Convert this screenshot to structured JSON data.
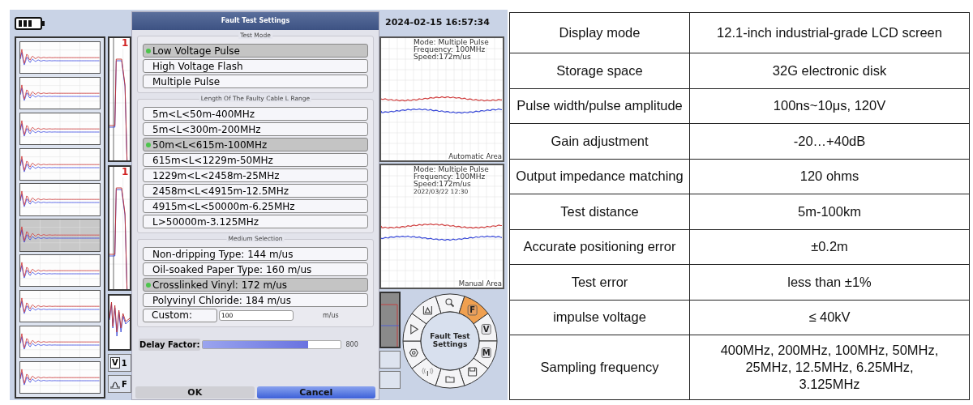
{
  "thumbnails": [
    {
      "selected": false
    },
    {
      "selected": false
    },
    {
      "selected": false
    },
    {
      "selected": false
    },
    {
      "selected": false
    },
    {
      "selected": true
    },
    {
      "selected": false
    },
    {
      "selected": false
    },
    {
      "selected": false
    },
    {
      "selected": false
    }
  ],
  "side_plots": {
    "labels": [
      "1",
      "1"
    ],
    "channel_key": "V",
    "channel_value": "1",
    "filter_label": "F"
  },
  "datetime": "2024-02-15 16:57:34",
  "plots": [
    {
      "info": [
        "Mode: Multiple Pulse",
        "Frequency: 100MHz",
        "Speed:172m/us"
      ],
      "area": "Automatic Area"
    },
    {
      "info": [
        "Mode: Multiple Pulse",
        "Frequency: 100MHz",
        "Speed:172m/us",
        "2022/03/22 12:30"
      ],
      "area": "Manual Area"
    }
  ],
  "dialog": {
    "title": "Fault Test Settings",
    "sections": [
      {
        "title": "Test Mode",
        "options": [
          {
            "label": "Low Voltage Pulse",
            "selected": true
          },
          {
            "label": "High Voltage Flash",
            "selected": false
          },
          {
            "label": "Multiple Pulse",
            "selected": false
          }
        ]
      },
      {
        "title": "Length Of The Faulty Cable L Range",
        "options": [
          {
            "label": "5m<L<50m-400MHz",
            "selected": false
          },
          {
            "label": "5m<L<300m-200MHz",
            "selected": false
          },
          {
            "label": "50m<L<615m-100MHz",
            "selected": true
          },
          {
            "label": "615m<L<1229m-50MHz",
            "selected": false
          },
          {
            "label": "1229m<L<2458m-25MHz",
            "selected": false
          },
          {
            "label": "2458m<L<4915m-12.5MHz",
            "selected": false
          },
          {
            "label": "4915m<L<50000m-6.25MHz",
            "selected": false
          },
          {
            "label": "L>50000m-3.125MHz",
            "selected": false
          }
        ]
      },
      {
        "title": "Medium Selection",
        "options": [
          {
            "label": "Non-dripping Type: 144 m/us",
            "selected": false
          },
          {
            "label": "Oil-soaked Paper Type: 160 m/us",
            "selected": false
          },
          {
            "label": "Crosslinked Vinyl: 172 m/us",
            "selected": true
          },
          {
            "label": "Polyvinyl Chloride: 184 m/us",
            "selected": false
          }
        ],
        "custom": {
          "label": "Custom:",
          "value": "100",
          "unit": "m/us"
        }
      }
    ],
    "delay": {
      "label": "Delay Factor:",
      "level": 0.76,
      "reading": "800"
    },
    "buttons": [
      {
        "label": "OK",
        "selected": false
      },
      {
        "label": "Cancel",
        "selected": true
      }
    ]
  },
  "wheel": {
    "center": "Fault  Test Settings",
    "items": [
      {
        "kind": "search",
        "selected": false
      },
      {
        "kind": "letter",
        "label": "F",
        "selected": true
      },
      {
        "kind": "letter",
        "label": "V",
        "selected": false
      },
      {
        "kind": "letter",
        "label": "M",
        "selected": false
      },
      {
        "kind": "save",
        "selected": false
      },
      {
        "kind": "folder",
        "selected": false
      },
      {
        "kind": "antenna",
        "selected": false
      },
      {
        "kind": "gear",
        "selected": false
      },
      {
        "kind": "play",
        "selected": false
      },
      {
        "kind": "ruler",
        "selected": false
      }
    ]
  },
  "specs": [
    {
      "name": "Display mode",
      "value": "12.1-inch industrial-grade LCD screen"
    },
    {
      "name": "Storage space",
      "value": "32G electronic disk"
    },
    {
      "name": "Pulse width/pulse amplitude",
      "value": "100ns~10μs, 120V"
    },
    {
      "name": "Gain adjustment",
      "value": "-20…+40dB"
    },
    {
      "name": "Output impedance matching",
      "value": "120 ohms"
    },
    {
      "name": "Test distance",
      "value": "5m-100km"
    },
    {
      "name": "Accurate positioning error",
      "value": "±0.2m"
    },
    {
      "name": "Test error",
      "value": "less than ±1%"
    },
    {
      "name": "impulse voltage",
      "value": "≤ 40kV"
    },
    {
      "name": "Sampling frequency",
      "value": "400MHz, 200MHz, 100MHz, 50MHz, 25MHz, 12.5MHz, 6.25MHz, 3.125MHz"
    }
  ]
}
